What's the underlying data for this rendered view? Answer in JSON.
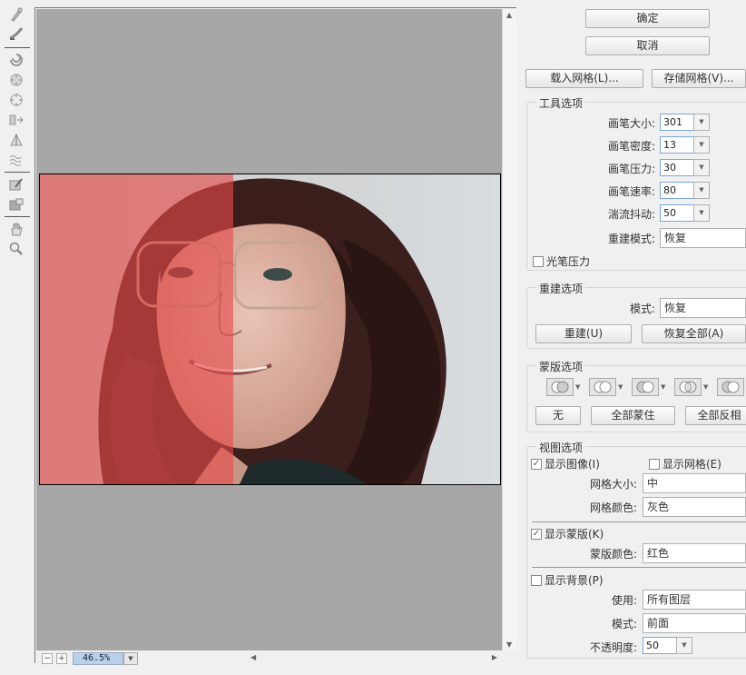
{
  "buttons": {
    "ok": "确定",
    "cancel": "取消",
    "load_mesh": "载入网格(L)...",
    "save_mesh": "存储网格(V)..."
  },
  "tool_options": {
    "title": "工具选项",
    "brush_size_label": "画笔大小:",
    "brush_size": "301",
    "brush_density_label": "画笔密度:",
    "brush_density": "13",
    "brush_pressure_label": "画笔压力:",
    "brush_pressure": "30",
    "brush_rate_label": "画笔速率:",
    "brush_rate": "80",
    "turbulent_jitter_label": "湍流抖动:",
    "turbulent_jitter": "50",
    "reconstruct_mode_label": "重建模式:",
    "reconstruct_mode": "恢复",
    "stylus_pressure": "光笔压力"
  },
  "reconstruct_options": {
    "title": "重建选项",
    "mode_label": "模式:",
    "mode": "恢复",
    "reconstruct_button": "重建(U)",
    "restore_all_button": "恢复全部(A)"
  },
  "mask_options": {
    "title": "蒙版选项",
    "none_button": "无",
    "mask_all_button": "全部蒙住",
    "invert_all_button": "全部反相"
  },
  "view_options": {
    "title": "视图选项",
    "show_image": "显示图像(I)",
    "show_mesh": "显示网格(E)",
    "mesh_size_label": "网格大小:",
    "mesh_size": "中",
    "mesh_color_label": "网格颜色:",
    "mesh_color": "灰色",
    "show_mask": "显示蒙版(K)",
    "mask_color_label": "蒙版颜色:",
    "mask_color": "红色",
    "show_backdrop": "显示背景(P)",
    "use_label": "使用:",
    "use": "所有图层",
    "mode_label": "模式:",
    "mode": "前面",
    "opacity_label": "不透明度:",
    "opacity": "50"
  },
  "zoom": {
    "value": "46.5%",
    "minus": "−",
    "plus": "+"
  },
  "icons": {
    "tools": [
      "forward-warp-icon",
      "reconstruct-icon",
      "twirl-icon",
      "pucker-icon",
      "bloat-icon",
      "push-left-icon",
      "mirror-icon",
      "turbulence-icon",
      "freeze-mask-icon",
      "thaw-mask-icon",
      "hand-icon",
      "zoom-icon"
    ]
  },
  "colors": {
    "mask_overlay": "#e64b4b",
    "canvas_bg": "#a7a7a7"
  }
}
